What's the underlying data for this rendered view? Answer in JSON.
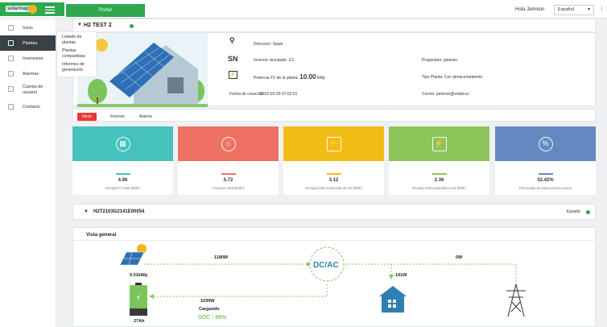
{
  "topbar": {
    "logo": "solarmap",
    "portal_tab": "Portal",
    "greeting": "Hola Jamison",
    "language": "Español",
    "more_icon": "more-vertical-icon"
  },
  "sidebar": {
    "items": [
      {
        "label": "Inicio",
        "icon": "home-icon"
      },
      {
        "label": "Plantas",
        "icon": "plant-icon",
        "active": true
      },
      {
        "label": "Inversores",
        "icon": "inverter-icon"
      },
      {
        "label": "Alarmas",
        "icon": "alarm-icon"
      },
      {
        "label": "Cuenta de usuario",
        "icon": "user-icon"
      },
      {
        "label": "Contacto",
        "icon": "contact-icon"
      }
    ],
    "submenu": [
      "Listado de plantas",
      "Plantas compartidas",
      "Informes de generación"
    ]
  },
  "plant": {
    "name": "H2 TEST 2",
    "status_color": "#2fa84f"
  },
  "info": {
    "address_label": "Dirección: Spain",
    "sn_icon": "SN",
    "inverter_label": "Inversor vinculado: 1/1",
    "owner_label": "Propietario: jamison",
    "power_label": "Potencia FV de la planta:",
    "power_value": "10.00",
    "power_unit": "kWp",
    "type_label": "Tipo Planta: Con almacenamiento",
    "created_label": "Fecha de creación:",
    "created_value": "2022-03-29 07:52:01",
    "email_label": "Correo: jamison@solati.es"
  },
  "tabs": [
    "Inicio",
    "Inversor",
    "Alarma"
  ],
  "tiles": [
    {
      "value": "4.96",
      "label": "Energía FV total (kWh)",
      "color": "#46c2bc",
      "icon": "solar-panel-icon",
      "glyph": "▦"
    },
    {
      "value": "5.72",
      "label": "Consumo total (kWh)",
      "color": "#ee7163",
      "icon": "house-power-icon",
      "glyph": "⌂"
    },
    {
      "value": "3.12",
      "label": "Energía total consumida de red (kWh)",
      "color": "#f2bc17",
      "icon": "tower-icon",
      "glyph": "⚡"
    },
    {
      "value": "2.36",
      "label": "Energía total importada a red (kWh)",
      "color": "#8dc55b",
      "icon": "tower-import-icon",
      "glyph": "⚡"
    },
    {
      "value": "52.42%",
      "label": "Porcentaje de autoconsumo actual",
      "color": "#6489c1",
      "icon": "percent-icon",
      "glyph": "%"
    }
  ],
  "device": {
    "id": "H2T2103G2141E00054",
    "estado_label": "Estado"
  },
  "overview": {
    "title": "Vista general",
    "pv_power": "0.01kWp",
    "pv_to_inv": "1180W",
    "inverter_label": "DC/AC",
    "grid_flow": "0W",
    "load_power": "141W",
    "battery_power": "1039W",
    "battery_status": "Cargando",
    "soc": "SOC : 80%",
    "battery_capacity": "27Ah",
    "flow_color": "#8dc55b"
  }
}
